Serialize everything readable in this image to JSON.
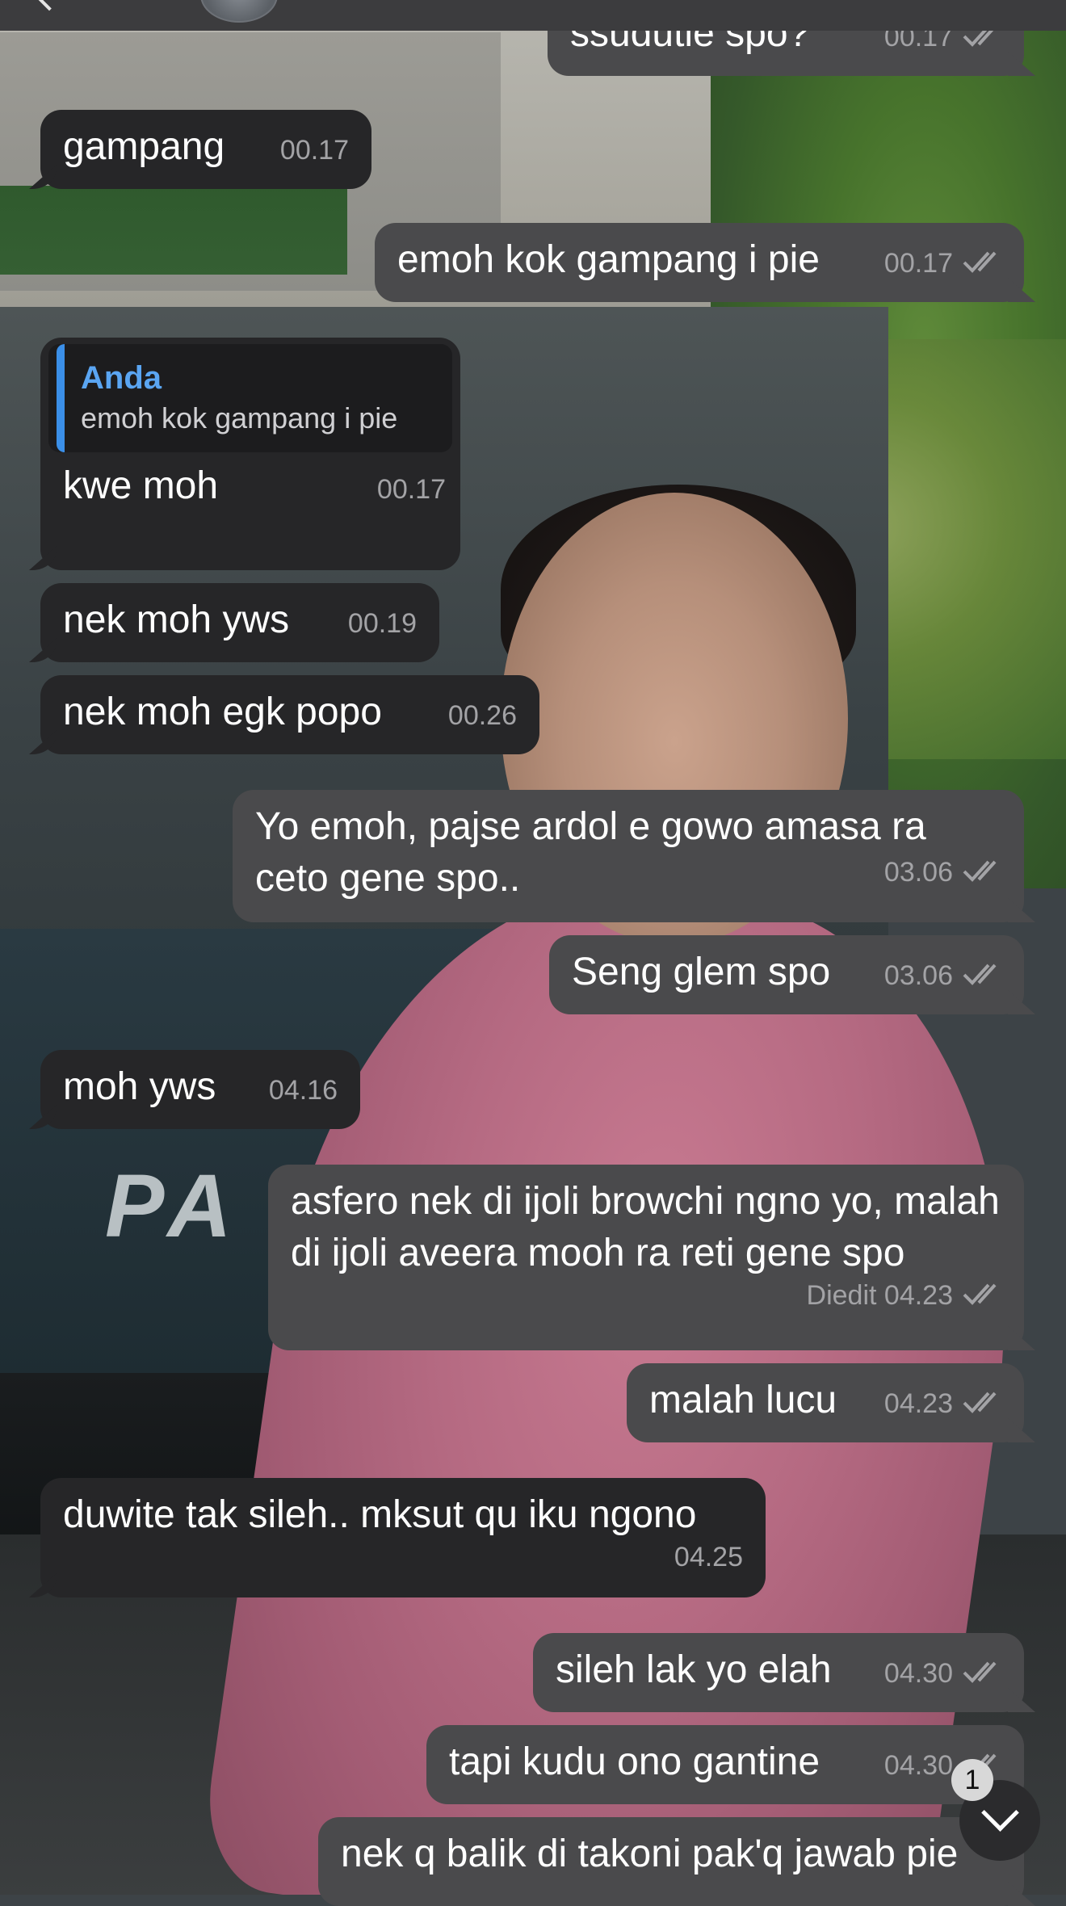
{
  "colors": {
    "incoming_bubble": "#262628",
    "outgoing_bubble": "#4a4a4c",
    "timestamp": "#a3a3a6",
    "reply_accent": "#3b8fe8",
    "reply_name": "#5aa5f2"
  },
  "wallpaper": {
    "car_logo_text": "PA"
  },
  "messages": [
    {
      "id": "m0",
      "direction": "out",
      "text": "ssudutie spo?",
      "time": "00.17",
      "read": true
    },
    {
      "id": "m1",
      "direction": "in",
      "text": "gampang",
      "time": "00.17"
    },
    {
      "id": "m2",
      "direction": "out",
      "text": "emoh kok gampang i pie",
      "time": "00.17",
      "read": true
    },
    {
      "id": "m3",
      "direction": "in",
      "reply_to": {
        "name": "Anda",
        "text": "emoh kok gampang i pie"
      },
      "text": "kwe moh",
      "time": "00.17"
    },
    {
      "id": "m4",
      "direction": "in",
      "text": "nek moh yws",
      "time": "00.19"
    },
    {
      "id": "m5",
      "direction": "in",
      "text": "nek moh egk popo",
      "time": "00.26"
    },
    {
      "id": "m6",
      "direction": "out",
      "text": "Yo emoh, pajse ardol e gowo amasa ra ceto gene spo..",
      "time": "03.06",
      "read": true
    },
    {
      "id": "m7",
      "direction": "out",
      "text": "Seng glem spo",
      "time": "03.06",
      "read": true
    },
    {
      "id": "m8",
      "direction": "in",
      "text": "moh yws",
      "time": "04.16"
    },
    {
      "id": "m9",
      "direction": "out",
      "text": "asfero nek di ijoli browchi ngno yo, malah di ijoli aveera mooh ra reti gene spo",
      "edited_label": "Diedit",
      "time": "04.23",
      "read": true
    },
    {
      "id": "m10",
      "direction": "out",
      "text": "malah lucu",
      "time": "04.23",
      "read": true
    },
    {
      "id": "m11",
      "direction": "in",
      "text": "duwite tak sileh.. mksut qu iku ngono",
      "time": "04.25"
    },
    {
      "id": "m12",
      "direction": "out",
      "text": "sileh lak yo elah",
      "time": "04.30",
      "read": true
    },
    {
      "id": "m13",
      "direction": "out",
      "text": "tapi kudu ono gantine",
      "time": "04.30",
      "read": true
    },
    {
      "id": "m14",
      "direction": "out",
      "text": "nek q balik di takoni pak'q jawab pie"
    }
  ],
  "scroll_button": {
    "unread_count": "1",
    "icon": "chevron-down-icon"
  },
  "header": {
    "back_icon": "chevron-left-icon",
    "avatar": "contact-avatar"
  }
}
